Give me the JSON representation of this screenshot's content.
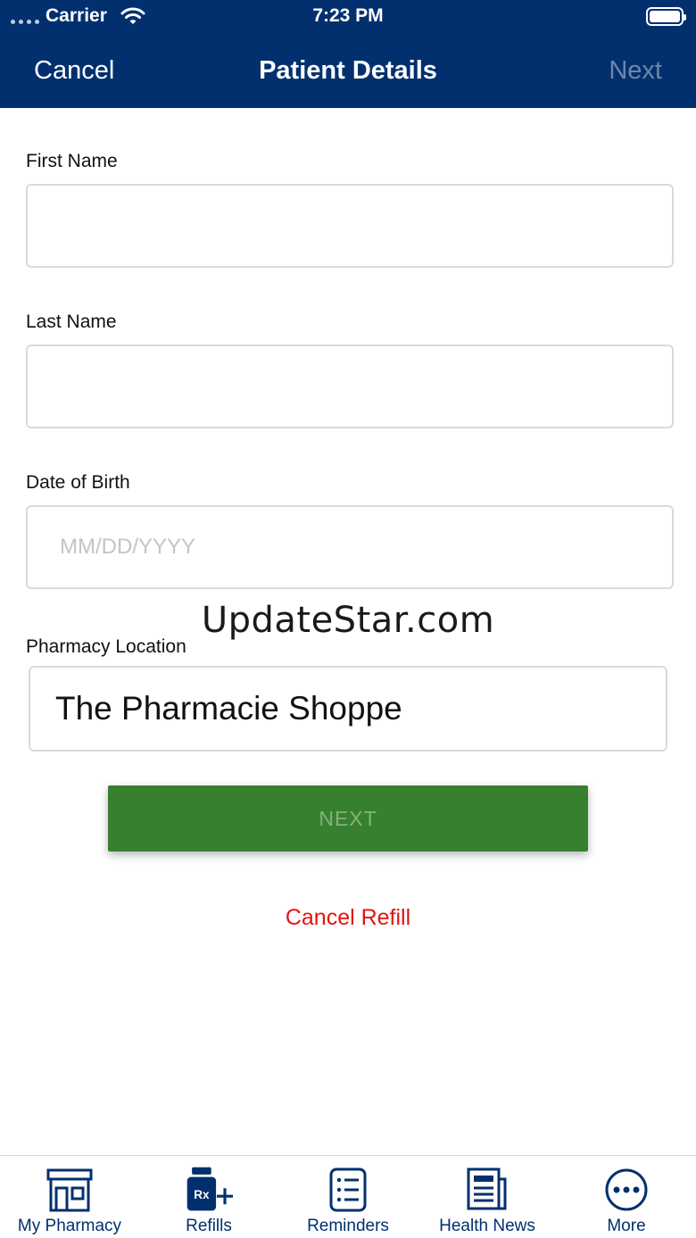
{
  "status_bar": {
    "carrier": "Carrier",
    "time": "7:23 PM"
  },
  "nav": {
    "cancel_label": "Cancel",
    "title": "Patient Details",
    "next_label": "Next"
  },
  "form": {
    "first_name": {
      "label": "First Name",
      "value": "",
      "placeholder": ""
    },
    "last_name": {
      "label": "Last Name",
      "value": "",
      "placeholder": ""
    },
    "date_of_birth": {
      "label": "Date of Birth",
      "value": "",
      "placeholder": "MM/DD/YYYY"
    },
    "pharmacy_location": {
      "label": "Pharmacy Location",
      "value": "The Pharmacie Shoppe"
    }
  },
  "watermark": "UpdateStar.com",
  "actions": {
    "next_button_label": "NEXT",
    "cancel_refill_label": "Cancel Refill"
  },
  "tabbar": {
    "items": [
      {
        "label": "My Pharmacy",
        "icon": "storefront-icon"
      },
      {
        "label": "Refills",
        "icon": "rx-bottle-plus-icon"
      },
      {
        "label": "Reminders",
        "icon": "checklist-icon"
      },
      {
        "label": "Health News",
        "icon": "newspaper-icon"
      },
      {
        "label": "More",
        "icon": "more-dots-icon"
      }
    ]
  },
  "colors": {
    "header_background": "#02306e",
    "next_button": "#37802f",
    "cancel_refill": "#e3140f",
    "tab_icon": "#02306e"
  }
}
